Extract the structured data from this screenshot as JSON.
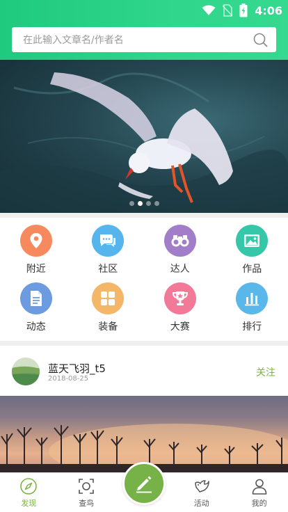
{
  "status_bar": {
    "time": "4:06"
  },
  "search": {
    "placeholder": "在此输入文章名/作者名"
  },
  "banner": {
    "page_count": 4,
    "active_page": 2
  },
  "categories": [
    {
      "label": "附近",
      "icon": "location-pin-icon",
      "color": "#f7895e"
    },
    {
      "label": "社区",
      "icon": "chat-bubbles-icon",
      "color": "#55b5ec"
    },
    {
      "label": "达人",
      "icon": "binoculars-icon",
      "color": "#a17ec7"
    },
    {
      "label": "作品",
      "icon": "picture-icon",
      "color": "#35c7a8"
    },
    {
      "label": "动态",
      "icon": "document-icon",
      "color": "#6d9be0"
    },
    {
      "label": "装备",
      "icon": "grid-squares-icon",
      "color": "#f4b668"
    },
    {
      "label": "大赛",
      "icon": "trophy-icon",
      "color": "#f27a98"
    },
    {
      "label": "排行",
      "icon": "bar-chart-icon",
      "color": "#5ab7ea"
    }
  ],
  "post": {
    "author": "蓝天飞羽_t5",
    "date": "2018-08-25",
    "follow_label": "关注"
  },
  "nav": {
    "discover": "发现",
    "identify_bird": "查鸟",
    "activity": "活动",
    "mine": "我的"
  },
  "colors": {
    "header_green": "#2fd68b",
    "accent_green": "#7cb342"
  }
}
